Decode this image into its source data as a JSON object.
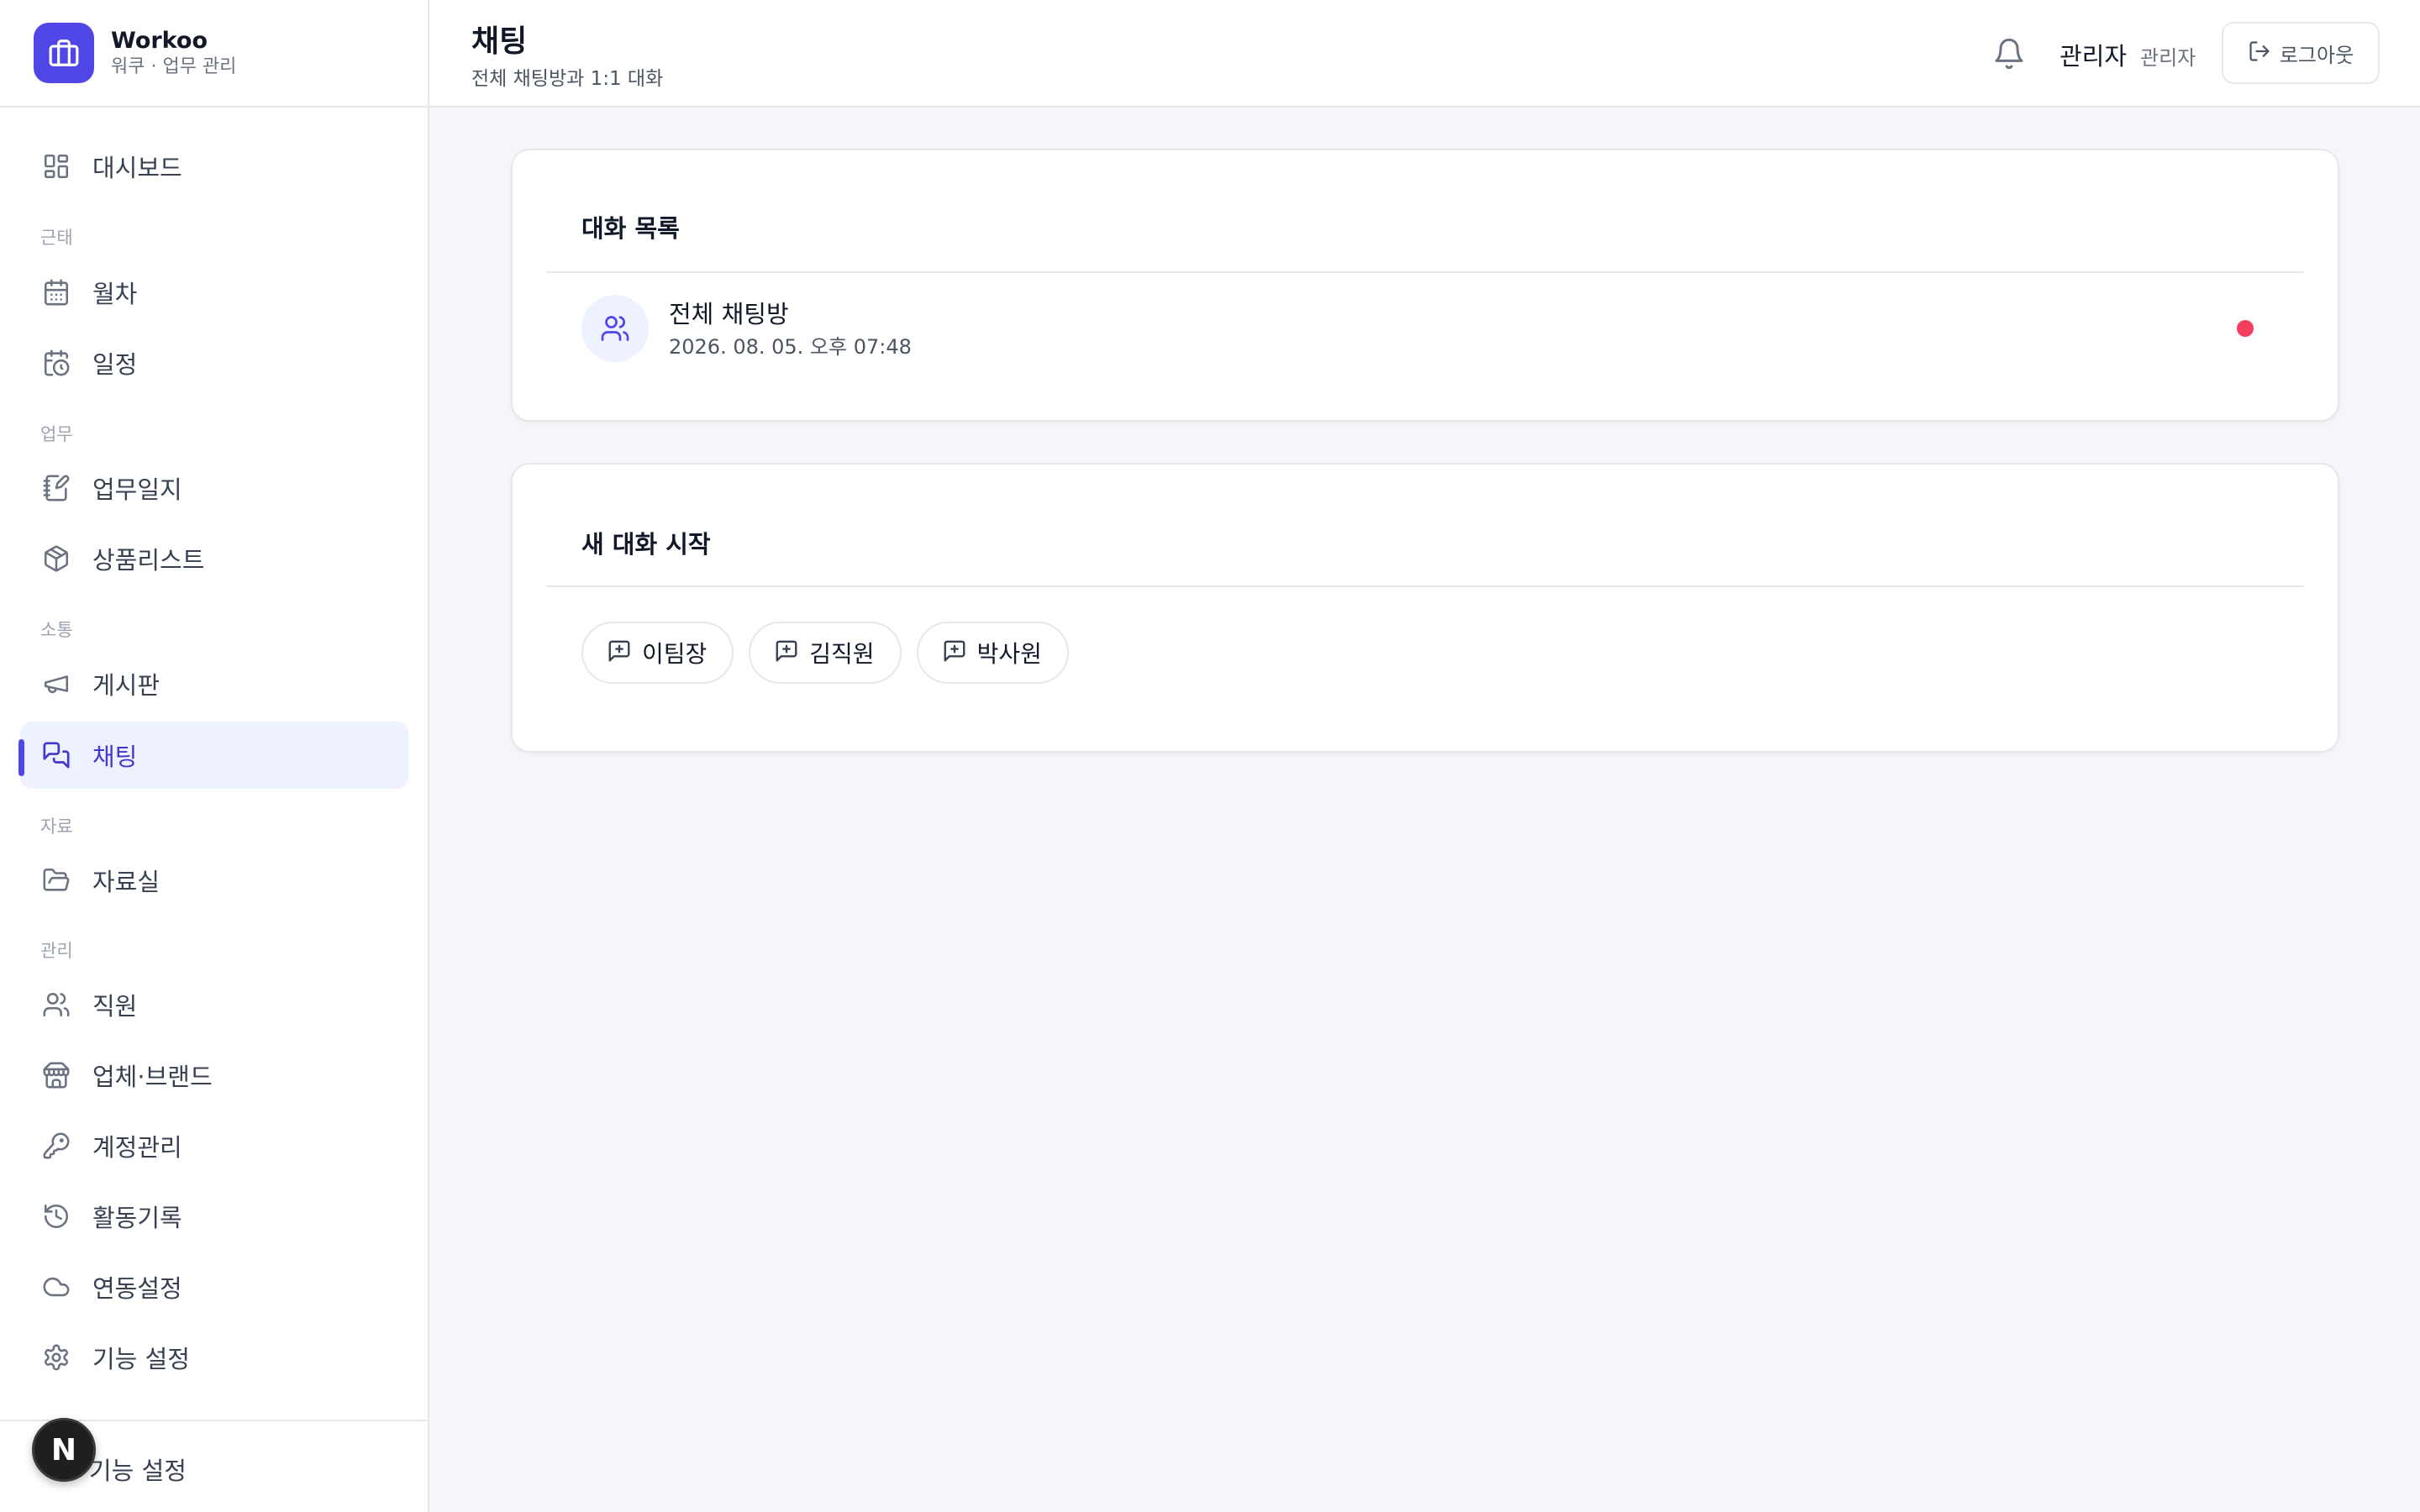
{
  "brand": {
    "name": "Workoo",
    "subtitle": "워쿠 · 업무 관리",
    "icon": "briefcase-icon",
    "color": "#4f46e5"
  },
  "sidebar": {
    "sections": [
      "근태",
      "업무",
      "소통",
      "자료",
      "관리"
    ],
    "items": [
      {
        "label": "대시보드",
        "icon": "dashboard-icon"
      },
      {
        "label": "월차",
        "icon": "calendar-icon"
      },
      {
        "label": "일정",
        "icon": "calendar-clock-icon"
      },
      {
        "label": "업무일지",
        "icon": "notebook-pen-icon"
      },
      {
        "label": "상품리스트",
        "icon": "package-icon"
      },
      {
        "label": "게시판",
        "icon": "megaphone-icon"
      },
      {
        "label": "채팅",
        "icon": "chat-icon",
        "active": true
      },
      {
        "label": "자료실",
        "icon": "folder-open-icon"
      },
      {
        "label": "직원",
        "icon": "users-icon"
      },
      {
        "label": "업체·브랜드",
        "icon": "store-icon"
      },
      {
        "label": "계정관리",
        "icon": "key-icon"
      },
      {
        "label": "활동기록",
        "icon": "history-icon"
      },
      {
        "label": "연동설정",
        "icon": "cloud-icon"
      },
      {
        "label": "기능 설정",
        "icon": "settings-icon"
      }
    ],
    "footer": {
      "label": "기능 설정",
      "icon": "settings-icon"
    },
    "dev_badge": "N"
  },
  "header": {
    "title": "채팅",
    "subtitle": "전체 채팅방과 1:1 대화",
    "user_name": "관리자",
    "user_role": "관리자",
    "logout_label": "로그아웃"
  },
  "conversations": {
    "title": "대화 목록",
    "items": [
      {
        "name": "전체 채팅방",
        "time": "2026. 08. 05. 오후 07:48",
        "unread": true
      }
    ]
  },
  "new_chat": {
    "title": "새 대화 시작",
    "people": [
      "이팀장",
      "김직원",
      "박사원"
    ]
  },
  "colors": {
    "accent": "#4f46e5",
    "active_bg": "#eef1ff",
    "unread": "#f43f5e"
  }
}
